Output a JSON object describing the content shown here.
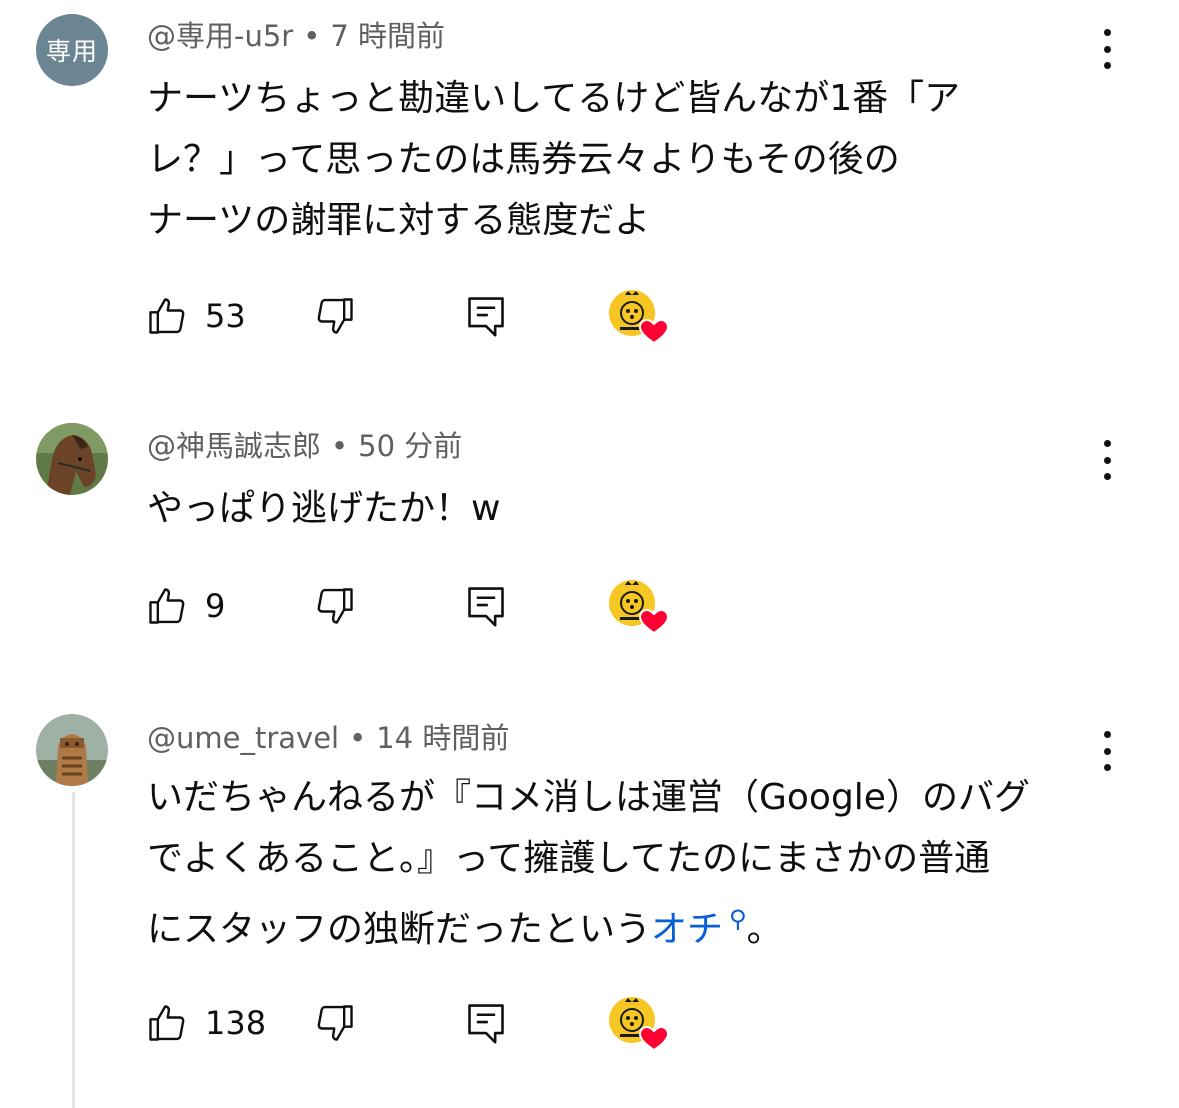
{
  "comments": [
    {
      "author": "@専用-u5r",
      "separator": "•",
      "time": "7 時間前",
      "avatar_text": "専用",
      "lines": [
        "ナーツちょっと勘違いしてるけど皆んなが1番「ア",
        "レ？」って思ったのは馬券云々よりもその後の",
        "ナーツの謝罪に対する態度だよ"
      ],
      "likes": "53"
    },
    {
      "author": "@神馬誠志郎",
      "separator": "•",
      "time": "50 分前",
      "lines": [
        "やっぱり逃げたか！w"
      ],
      "likes": "9"
    },
    {
      "author": "@ume_travel",
      "separator": "•",
      "time": "14 時間前",
      "lines": [
        "いだちゃんねるが『コメ消しは運営（Google）のバグ",
        "でよくあること。』って擁護してたのにまさかの普通"
      ],
      "line3_prefix": "にスタッフの独断だったという",
      "line3_link": "オチ",
      "line3_suffix": "。",
      "likes": "138"
    }
  ],
  "icons": {
    "like": "thumbs-up-icon",
    "dislike": "thumbs-down-icon",
    "reply": "reply-icon",
    "more": "more-vert-icon",
    "creator_heart": "creator-heart-icon",
    "search_link": "search-icon"
  },
  "colors": {
    "link": "#065fd4",
    "heart": "#ff0033",
    "creator_badge": "#f6c624",
    "meta_text": "#606060"
  }
}
